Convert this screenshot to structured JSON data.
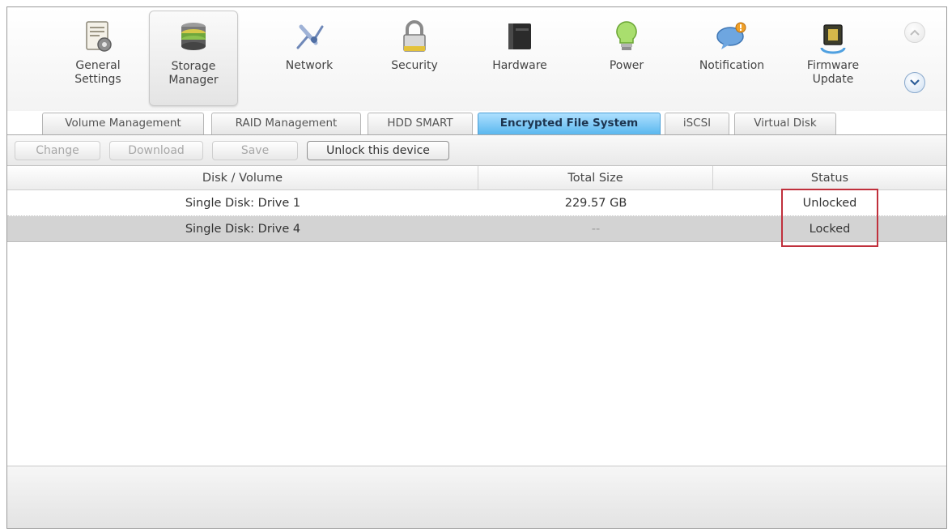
{
  "topbar": {
    "items": [
      {
        "label": "General Settings",
        "icon": "general-settings-icon"
      },
      {
        "label": "Storage Manager",
        "icon": "storage-manager-icon",
        "active": true
      },
      {
        "label": "Network",
        "icon": "network-icon"
      },
      {
        "label": "Security",
        "icon": "lock-icon"
      },
      {
        "label": "Hardware",
        "icon": "hardware-icon"
      },
      {
        "label": "Power",
        "icon": "lightbulb-icon"
      },
      {
        "label": "Notification",
        "icon": "notification-icon"
      },
      {
        "label": "Firmware Update",
        "icon": "firmware-chip-icon"
      }
    ]
  },
  "tabs": [
    {
      "label": "Volume Management"
    },
    {
      "label": "RAID Management"
    },
    {
      "label": "HDD SMART"
    },
    {
      "label": "Encrypted File System",
      "active": true
    },
    {
      "label": "iSCSI"
    },
    {
      "label": "Virtual Disk"
    }
  ],
  "toolbar": {
    "change_label": "Change",
    "download_label": "Download",
    "save_label": "Save",
    "unlock_label": "Unlock this device"
  },
  "table": {
    "columns": [
      "Disk / Volume",
      "Total Size",
      "Status"
    ],
    "rows": [
      {
        "disk": "Single Disk: Drive 1",
        "size": "229.57 GB",
        "status": "Unlocked"
      },
      {
        "disk": "Single Disk: Drive 4",
        "size": "--",
        "status": "Locked",
        "selected": true
      }
    ]
  },
  "colors": {
    "active_tab": "#5ab7ee",
    "highlight_box": "#c0303c",
    "selected_row": "#d3d3d3"
  }
}
